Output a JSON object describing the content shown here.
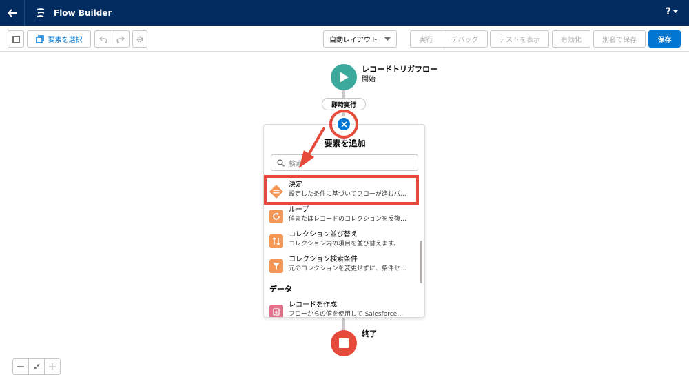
{
  "header": {
    "app_title": "Flow Builder",
    "help_label": "?"
  },
  "toolbar": {
    "select_elements_label": "要素を選択",
    "layout_select_value": "自動レイアウト",
    "run_label": "実行",
    "debug_label": "デバッグ",
    "view_tests_label": "テストを表示",
    "activate_label": "有効化",
    "save_as_label": "別名で保存",
    "save_label": "保存"
  },
  "canvas": {
    "start_node": {
      "title": "レコードトリガフロー",
      "subtitle": "開始"
    },
    "run_pill": "即時実行",
    "end_node": {
      "label": "終了"
    }
  },
  "add_element_popover": {
    "title": "要素を追加",
    "search_placeholder": "検索",
    "items": [
      {
        "name": "決定",
        "desc": "設定した条件に基づいてフローが進むパ…",
        "icon": "decision-icon",
        "color": "#f49756"
      },
      {
        "name": "ループ",
        "desc": "値またはレコードのコレクションを反復…",
        "icon": "loop-icon",
        "color": "#f49756"
      },
      {
        "name": "コレクション並び替え",
        "desc": "コレクション内の項目を並び替えます。",
        "icon": "sort-icon",
        "color": "#f49756"
      },
      {
        "name": "コレクション検索条件",
        "desc": "元のコレクションを変更せずに、条件セ…",
        "icon": "filter-icon",
        "color": "#f49756"
      }
    ],
    "section_data": "データ",
    "data_items": [
      {
        "name": "レコードを作成",
        "desc": "フローからの値を使用して Salesforce…",
        "icon": "create-record-icon",
        "color": "#e3738c"
      }
    ]
  },
  "colors": {
    "header_bg": "#032d60",
    "brand": "#0176d3",
    "start": "#3ba99c",
    "end": "#e64a3b",
    "highlight": "#e64a3b"
  }
}
